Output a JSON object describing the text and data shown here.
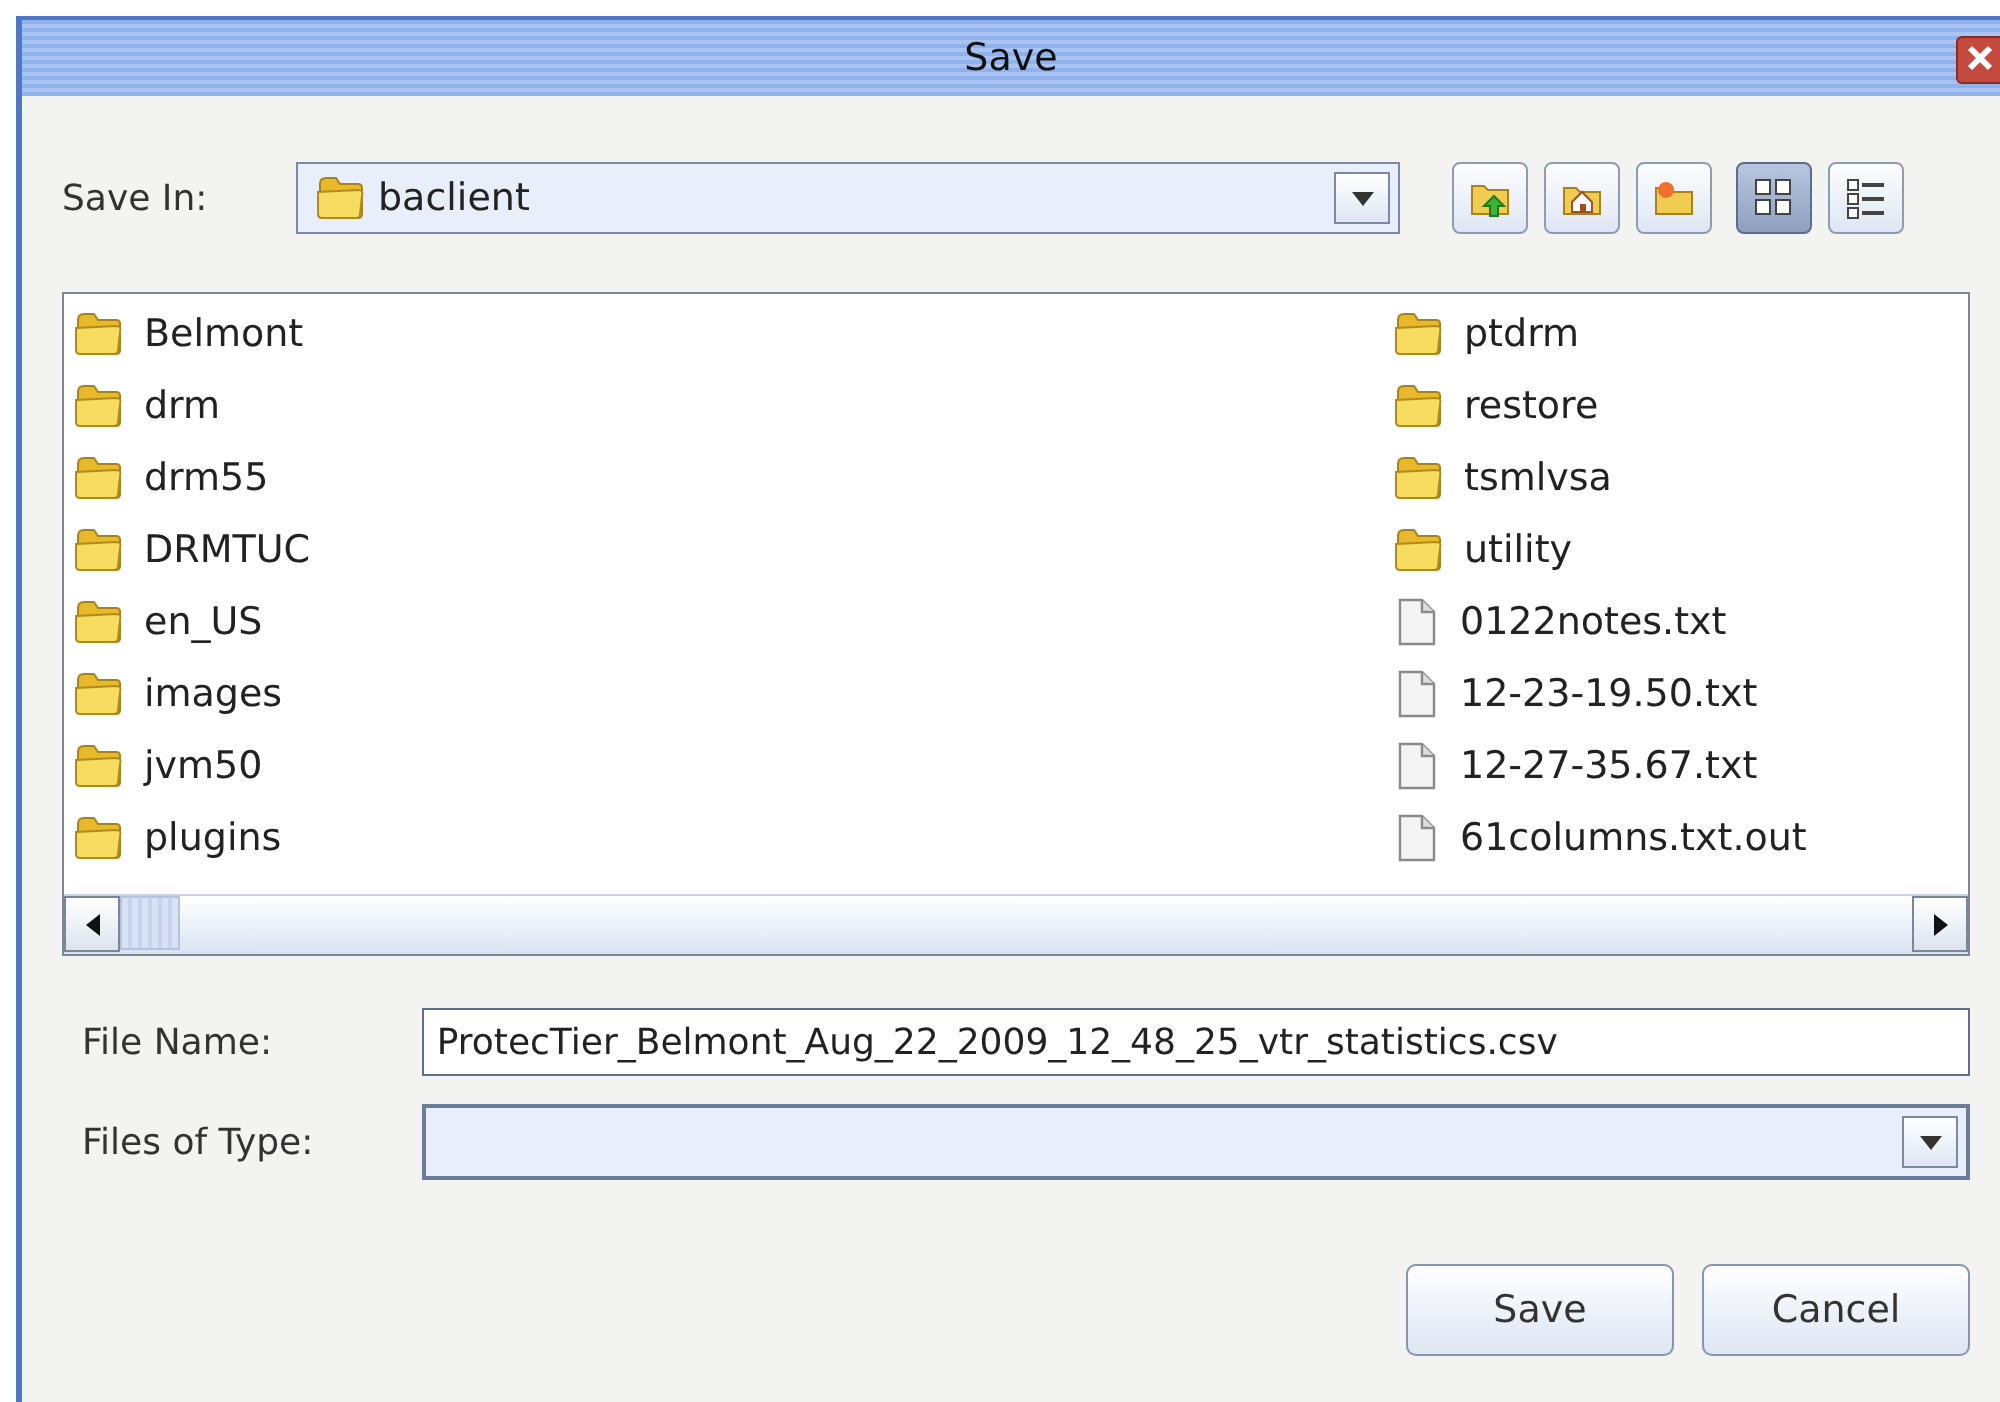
{
  "window": {
    "title": "Save"
  },
  "save_in": {
    "label": "Save In:",
    "value": "baclient"
  },
  "toolbar": [
    {
      "kind": "up",
      "selected": false
    },
    {
      "kind": "home",
      "selected": false
    },
    {
      "kind": "new-folder",
      "selected": false
    },
    {
      "kind": "list",
      "selected": true
    },
    {
      "kind": "details",
      "selected": false
    }
  ],
  "files": [
    {
      "name": "Belmont",
      "kind": "folder"
    },
    {
      "name": "drm",
      "kind": "folder"
    },
    {
      "name": "drm55",
      "kind": "folder"
    },
    {
      "name": "DRMTUC",
      "kind": "folder"
    },
    {
      "name": "en_US",
      "kind": "folder"
    },
    {
      "name": "images",
      "kind": "folder"
    },
    {
      "name": "jvm50",
      "kind": "folder"
    },
    {
      "name": "plugins",
      "kind": "folder"
    },
    {
      "name": "ptdrm",
      "kind": "folder"
    },
    {
      "name": "restore",
      "kind": "folder"
    },
    {
      "name": "tsmlvsa",
      "kind": "folder"
    },
    {
      "name": "utility",
      "kind": "folder"
    },
    {
      "name": "0122notes.txt",
      "kind": "file"
    },
    {
      "name": "12-23-19.50.txt",
      "kind": "file"
    },
    {
      "name": "12-27-35.67.txt",
      "kind": "file"
    },
    {
      "name": "61columns.txt.out",
      "kind": "file"
    }
  ],
  "file_name": {
    "label": "File Name:",
    "value": "ProtecTier_Belmont_Aug_22_2009_12_48_25_vtr_statistics.csv"
  },
  "file_type": {
    "label": "Files of Type:"
  },
  "buttons": [
    "Save",
    "Cancel"
  ]
}
